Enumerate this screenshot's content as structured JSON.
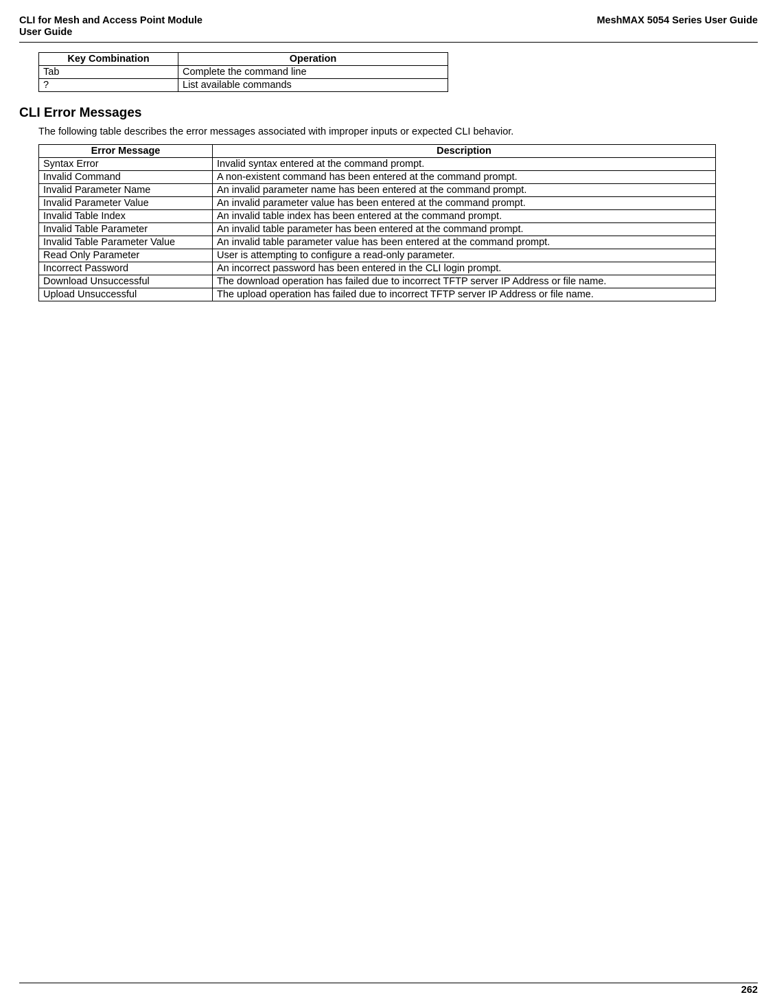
{
  "header": {
    "left_line1": "CLI for Mesh and Access Point Module",
    "left_line2": " User Guide",
    "right": "MeshMAX 5054 Series User Guide"
  },
  "key_table": {
    "headers": [
      "Key Combination",
      "Operation"
    ],
    "rows": [
      [
        "Tab",
        "Complete the command line"
      ],
      [
        "?",
        "List available commands"
      ]
    ]
  },
  "section": {
    "heading": "CLI Error Messages",
    "intro": "The following table describes the error messages associated with improper inputs or expected CLI behavior."
  },
  "error_table": {
    "headers": [
      "Error Message",
      "Description"
    ],
    "rows": [
      [
        "Syntax Error",
        "Invalid syntax entered at the command prompt."
      ],
      [
        "Invalid Command",
        "A non-existent command has been entered at the command prompt."
      ],
      [
        "Invalid Parameter Name",
        "An invalid parameter name has been entered at the command prompt."
      ],
      [
        "Invalid Parameter Value",
        "An invalid parameter value has been entered at the command prompt."
      ],
      [
        "Invalid Table Index",
        "An invalid table index has been entered at the command prompt."
      ],
      [
        "Invalid Table Parameter",
        "An invalid table parameter has been entered at the command prompt."
      ],
      [
        "Invalid Table Parameter Value",
        "An invalid table parameter value has been entered at the command prompt."
      ],
      [
        "Read Only Parameter",
        "User is attempting to configure a read-only parameter."
      ],
      [
        "Incorrect Password",
        "An incorrect password has been entered in the CLI login prompt."
      ],
      [
        "Download Unsuccessful",
        "The download operation has failed due to incorrect TFTP server IP Address or file name."
      ],
      [
        "Upload Unsuccessful",
        "The upload operation has failed due to incorrect TFTP server IP Address or file name."
      ]
    ]
  },
  "footer": {
    "page": "262"
  }
}
